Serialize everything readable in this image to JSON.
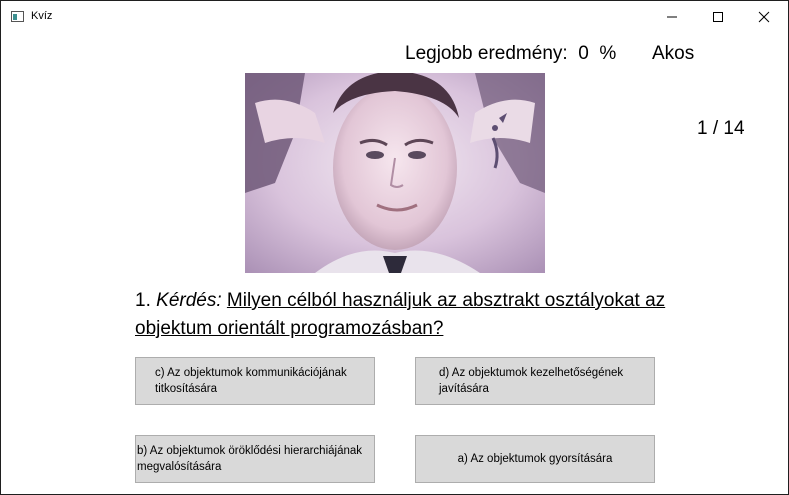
{
  "window": {
    "title": "Kvíz"
  },
  "header": {
    "best_score_label": "Legjobb eredmény:",
    "best_score_value": "0",
    "best_score_unit": "%",
    "username": "Akos"
  },
  "progress": {
    "counter": "1 / 14"
  },
  "question": {
    "number": "1.",
    "label": "Kérdés:",
    "text": "Milyen célból használjuk az absztrakt osztályokat az objektum orientált programozásban?"
  },
  "answers": {
    "c": "c) Az objektumok kommunikációjának titkosítására",
    "d": "d) Az objektumok kezelhetőségének javítására",
    "b": "b) Az objektumok öröklődési hierarchiájának megvalósítására",
    "a": "a) Az objektumok gyorsítására"
  },
  "icons": {
    "app": "app-window-icon",
    "minimize": "minimize-icon",
    "maximize": "maximize-icon",
    "close": "close-icon"
  }
}
